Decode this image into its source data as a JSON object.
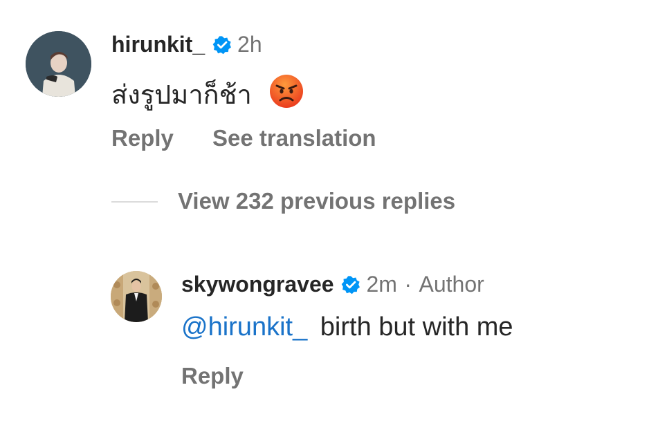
{
  "comment": {
    "username": "hirunkit_",
    "time": "2h",
    "text": "ส่งรูปมาก็ช้า",
    "emoji": "😡",
    "reply_label": "Reply",
    "translate_label": "See translation"
  },
  "thread": {
    "view_replies_label": "View 232 previous replies"
  },
  "reply": {
    "username": "skywongravee",
    "time": "2m",
    "separator": "·",
    "role_label": "Author",
    "mention": "@hirunkit_",
    "text": "birth but with me",
    "reply_label": "Reply"
  },
  "colors": {
    "verified": "#0095f6",
    "mention": "#1a73c9",
    "secondary_text": "#737373",
    "emoji_face": "#f04a2a"
  },
  "icons": {
    "verified": "verified-badge-icon"
  }
}
